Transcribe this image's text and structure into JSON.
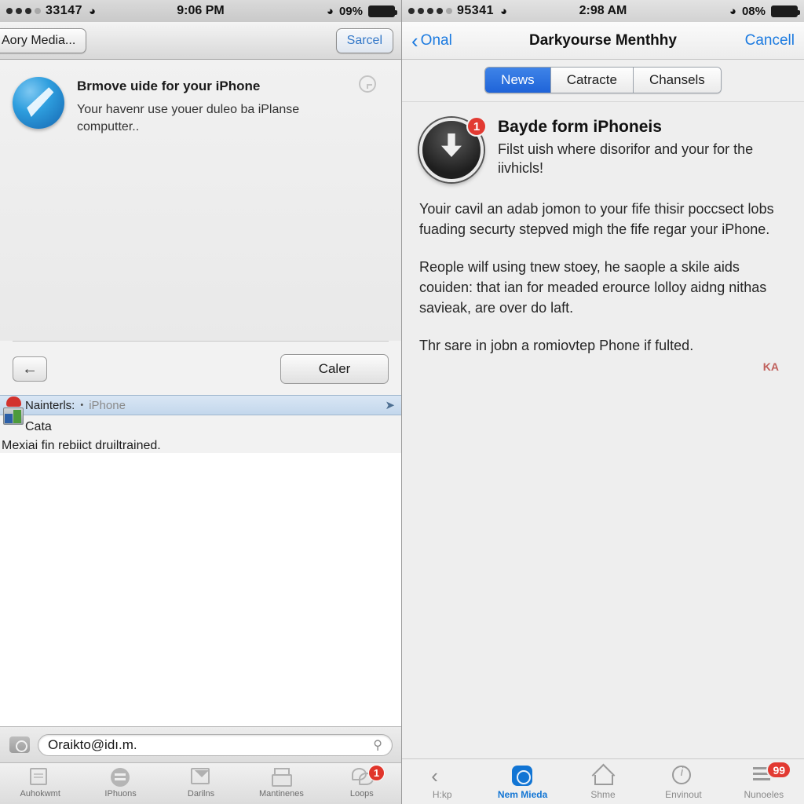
{
  "left": {
    "status": {
      "signal_dots": 4,
      "signal_filled": 3,
      "carrier": "33147",
      "wifi_icon": "wifi-icon",
      "time": "9:06 PM",
      "battery": "09%"
    },
    "nav": {
      "back_label": "Aory Media...",
      "cancel_label": "Sarcel"
    },
    "card": {
      "icon": "safari-icon",
      "title": "Brmove uide for your iPhone",
      "subtitle": "Your havenr use youer duleo ba iPlanse computter..",
      "accessory_icon": "clock-icon"
    },
    "toolbar": {
      "back_icon": "arrow-left-icon",
      "button_label": "Caler"
    },
    "maintenance": {
      "title": "Nainterls:",
      "separator": "•",
      "device": "iPhone",
      "share_icon": "share-icon",
      "lock_icon": "lock-icon",
      "line2": "Cata",
      "line3": "Mexiai fin rebiict druiltrained."
    },
    "search": {
      "camera_icon": "camera-icon",
      "value": "Oraikto@idı.m.",
      "search_icon": "magnifier-icon"
    },
    "tabs": [
      {
        "label": "Auhokwmt",
        "icon": "document-icon",
        "badge": ""
      },
      {
        "label": "IPhuons",
        "icon": "contact-circle-icon",
        "badge": ""
      },
      {
        "label": "Darilns",
        "icon": "mail-icon",
        "badge": ""
      },
      {
        "label": "Mantinenes",
        "icon": "printer-icon",
        "badge": ""
      },
      {
        "label": "Loops",
        "icon": "chat-icon",
        "badge": "1"
      }
    ]
  },
  "right": {
    "status": {
      "signal_dots": 5,
      "signal_filled": 4,
      "carrier": "95341",
      "wifi_icon": "wifi-icon",
      "time": "2:98 AM",
      "battery": "08%"
    },
    "nav": {
      "back_icon": "chevron-left-icon",
      "back_label": "Onal",
      "title": "Darkyourse Menthhy",
      "cancel_label": "Cancell"
    },
    "segments": [
      {
        "label": "News",
        "active": true
      },
      {
        "label": "Catracte",
        "active": false
      },
      {
        "label": "Chansels",
        "active": false
      }
    ],
    "article": {
      "icon": "download-circle-icon",
      "badge": "1",
      "title": "Bayde form iPhoneis",
      "lead": "Filst uish where disorifor and your for the iivhicls!",
      "paragraph1": "Youir cavil an adab jomon to your fife thisir poccsect lobs fuading securty stepved migh the fife regar your iPhone.",
      "paragraph2": "Reople wilf using tnew stoey, he saople a skile aids couiden: that ian for meaded erource lolloy aidng nithas savieak, are over do laft.",
      "paragraph3": "Thr sare in jobn a romiovtep Phone if fulted.",
      "signature": "KА"
    },
    "tabs": [
      {
        "label": "H:kp",
        "icon": "chevron-left-icon",
        "active": false,
        "badge": ""
      },
      {
        "label": "Nem Mieda",
        "icon": "flower-app-icon",
        "active": true,
        "badge": ""
      },
      {
        "label": "Shme",
        "icon": "home-icon",
        "active": false,
        "badge": ""
      },
      {
        "label": "Envinout",
        "icon": "info-icon",
        "active": false,
        "badge": ""
      },
      {
        "label": "Nunoeles",
        "icon": "list-icon",
        "active": false,
        "badge": "99"
      }
    ]
  },
  "colors": {
    "accent_blue": "#1275d4",
    "segment_active": "#2f71de",
    "badge_red": "#e23a32",
    "highlight_row": "#c9dbee"
  }
}
